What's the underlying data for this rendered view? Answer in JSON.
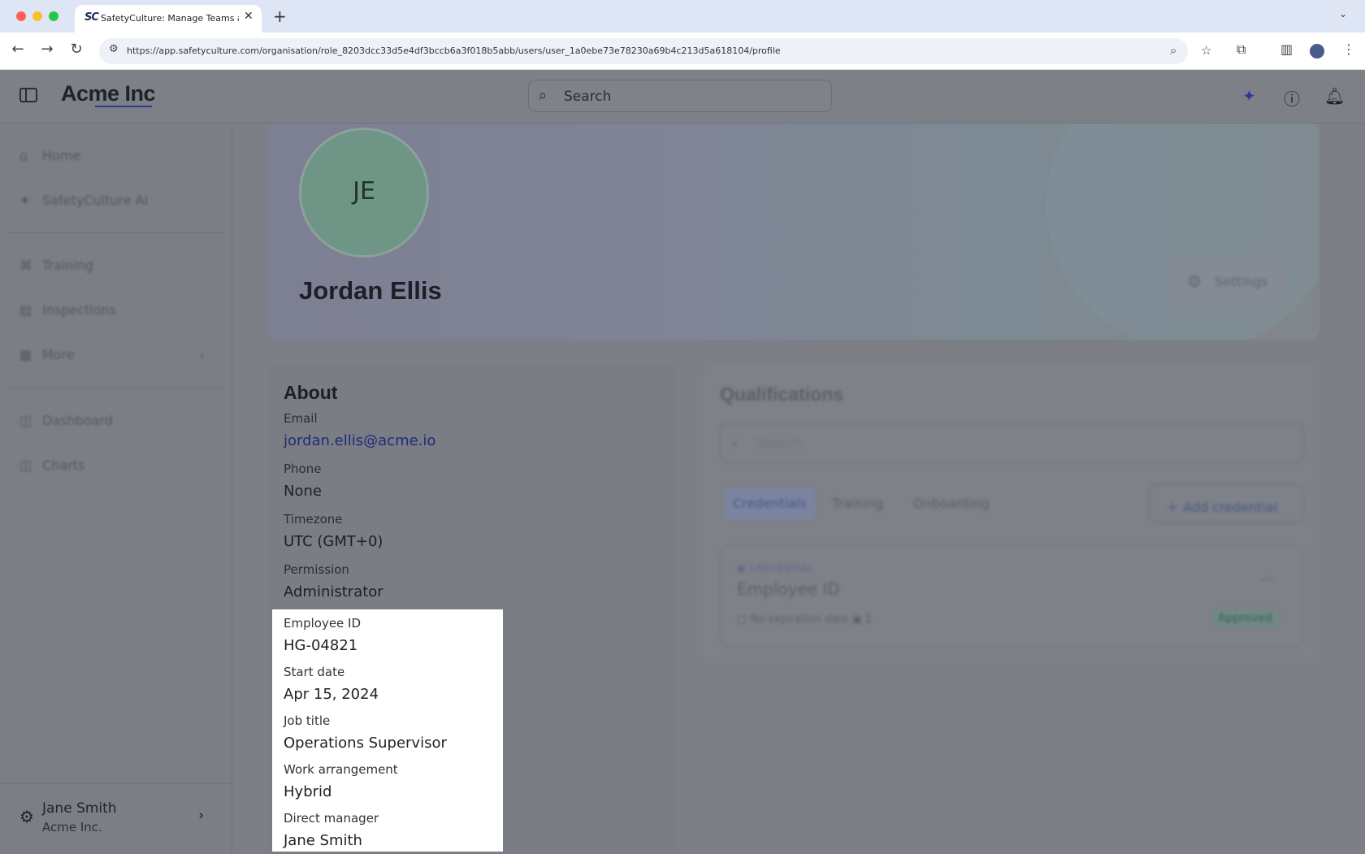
{
  "browser": {
    "tab_favicon_text": "SC",
    "tab_title": "SafetyCulture: Manage Teams and...",
    "tab_close": "✕",
    "new_tab": "+",
    "url": "https://app.safetyculture.com/organisation/role_8203dcc33d5e4df3bccb6a3f018b5abb/users/user_1a0ebe73e78230a69b4c213d5a618104/profile"
  },
  "header": {
    "brand": "Acme Inc",
    "search_placeholder": "Search"
  },
  "sidebar": {
    "items": [
      {
        "label": "Home",
        "icon": "home-icon"
      },
      {
        "label": "SafetyCulture AI",
        "icon": "sparkle-icon"
      },
      {
        "label": "Training",
        "icon": "training-icon"
      },
      {
        "label": "Inspections",
        "icon": "clipboard-icon"
      },
      {
        "label": "More",
        "icon": "grid-icon"
      },
      {
        "label": "Dashboard",
        "icon": "dashboard-icon"
      },
      {
        "label": "Charts",
        "icon": "chart-icon"
      }
    ],
    "user": {
      "name": "Jane Smith",
      "org": "Acme Inc."
    }
  },
  "profile": {
    "initials": "JE",
    "name": "Jordan Ellis",
    "settings_label": "Settings"
  },
  "about": {
    "title": "About",
    "fields": [
      {
        "label": "Email",
        "value": "jordan.ellis@acme.io"
      },
      {
        "label": "Phone",
        "value": "None"
      },
      {
        "label": "Timezone",
        "value": "UTC (GMT+0)"
      },
      {
        "label": "Permission",
        "value": "Administrator"
      }
    ],
    "highlighted_fields": [
      {
        "label": "Employee ID",
        "value": "HG-04821"
      },
      {
        "label": "Start date",
        "value": "Apr 15, 2024"
      },
      {
        "label": "Job title",
        "value": "Operations Supervisor"
      },
      {
        "label": "Work arrangement",
        "value": "Hybrid"
      },
      {
        "label": "Direct manager",
        "value": "Jane Smith"
      }
    ]
  },
  "qualifications": {
    "title": "Qualifications",
    "search_placeholder": "Search",
    "tabs": [
      "Credentials",
      "Training",
      "Onboarding"
    ],
    "add_button": "Add credential",
    "credential": {
      "type": "CREDENTIAL",
      "name": "Employee ID",
      "expiry": "No expiration date",
      "attachments": "1",
      "status": "Approved"
    }
  }
}
